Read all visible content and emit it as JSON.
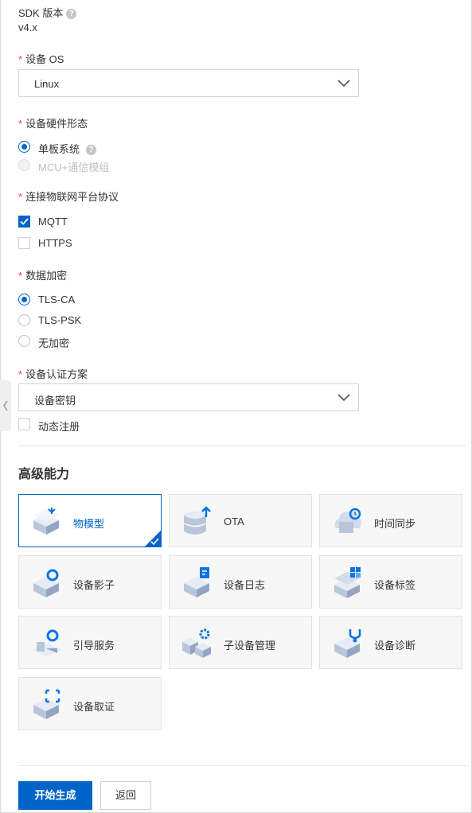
{
  "sdk": {
    "label": "SDK 版本",
    "value": "v4.x"
  },
  "os": {
    "label": "设备 OS",
    "value": "Linux"
  },
  "hardware": {
    "label": "设备硬件形态",
    "options": [
      {
        "label": "单板系统",
        "selected": true,
        "disabled": false
      },
      {
        "label": "MCU+通信模组",
        "selected": false,
        "disabled": true
      }
    ]
  },
  "protocol": {
    "label": "连接物联网平台协议",
    "options": [
      {
        "label": "MQTT",
        "checked": true
      },
      {
        "label": "HTTPS",
        "checked": false
      }
    ]
  },
  "encryption": {
    "label": "数据加密",
    "options": [
      {
        "label": "TLS-CA",
        "selected": true
      },
      {
        "label": "TLS-PSK",
        "selected": false
      },
      {
        "label": "无加密",
        "selected": false
      }
    ]
  },
  "auth": {
    "label": "设备认证方案",
    "value": "设备密钥",
    "dynamic_register": {
      "label": "动态注册",
      "checked": false
    }
  },
  "advanced": {
    "title": "高级能力",
    "cards": [
      {
        "label": "物模型",
        "selected": true,
        "icon": "thing-model-icon"
      },
      {
        "label": "OTA",
        "selected": false,
        "icon": "ota-icon"
      },
      {
        "label": "时间同步",
        "selected": false,
        "icon": "time-sync-icon"
      },
      {
        "label": "设备影子",
        "selected": false,
        "icon": "device-shadow-icon"
      },
      {
        "label": "设备日志",
        "selected": false,
        "icon": "device-log-icon"
      },
      {
        "label": "设备标签",
        "selected": false,
        "icon": "device-tag-icon"
      },
      {
        "label": "引导服务",
        "selected": false,
        "icon": "bootstrap-icon"
      },
      {
        "label": "子设备管理",
        "selected": false,
        "icon": "sub-device-icon"
      },
      {
        "label": "设备诊断",
        "selected": false,
        "icon": "device-diagnose-icon"
      },
      {
        "label": "设备取证",
        "selected": false,
        "icon": "device-evidence-icon"
      }
    ]
  },
  "actions": {
    "generate": "开始生成",
    "back": "返回"
  },
  "colors": {
    "accent": "#0064c8",
    "required": "#e64545"
  }
}
